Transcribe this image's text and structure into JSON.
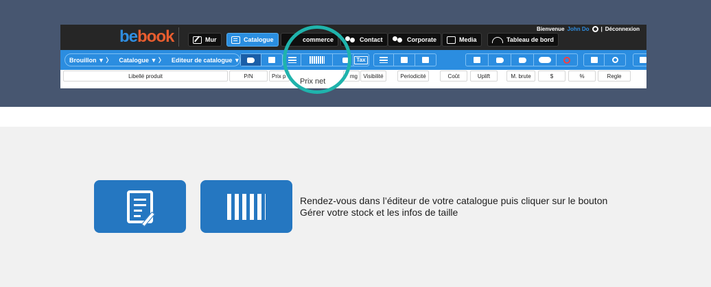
{
  "app": {
    "logo": {
      "part1": "be",
      "part2": "book"
    },
    "nav": [
      {
        "label": "Mur",
        "icon": "edit-icon"
      },
      {
        "label": "Catalogue",
        "icon": "catalog-icon",
        "active": true
      },
      {
        "label": "commerce",
        "icon": "commerce-icon"
      },
      {
        "label": "Contact",
        "icon": "contact-icon"
      },
      {
        "label": "Corporate",
        "icon": "corporate-icon"
      },
      {
        "label": "Media",
        "icon": "media-icon"
      },
      {
        "label": "Tableau de bord",
        "icon": "dashboard-icon"
      }
    ],
    "welcome": {
      "text": "Bienvenue",
      "user": "John Do",
      "separator": "|",
      "logout": "Déconnexion"
    },
    "breadcrumb": [
      "Brouillon",
      "Catalogue",
      "Editeur de catalogue"
    ],
    "toolbar": {
      "tax_label": "Tax"
    },
    "columns": [
      "Libellé produit",
      "P/N",
      "Prix p",
      "mg",
      "Visibilité",
      "Periodicité",
      "Coût",
      "Uplift",
      "M. brute",
      "$",
      "%",
      "Regle"
    ],
    "tooltip": "Prix net"
  },
  "instruction": "Rendez-vous dans l’éditeur de votre catalogue puis cliquer sur le bouton Gérer votre stock et les infos de taille",
  "colors": {
    "banner": "#475670",
    "accent": "#2b8de0",
    "highlight": "#1fb3ac",
    "button": "#2577c1"
  }
}
